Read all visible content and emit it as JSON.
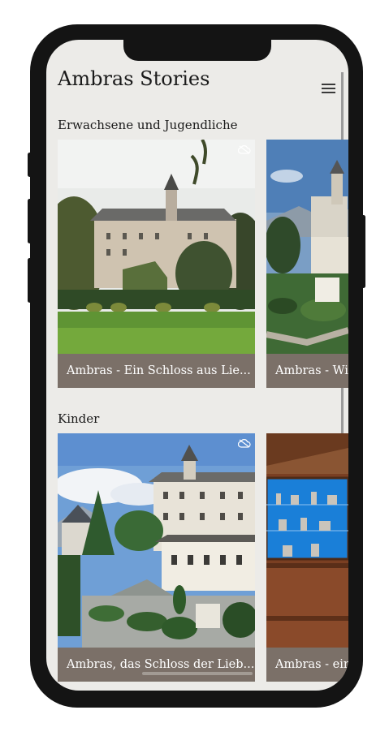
{
  "app": {
    "title": "Ambras Stories",
    "menu_icon": "hamburger-menu-icon"
  },
  "sections": [
    {
      "title": "Erwachsene und Jugendliche",
      "cards": [
        {
          "caption": "Ambras - Ein Schloss aus Lie...",
          "image": "castle-garden-photo"
        },
        {
          "caption": "Ambras - Wi",
          "image": "castle-aerial-garden-photo"
        }
      ]
    },
    {
      "title": "Kinder",
      "cards": [
        {
          "caption": "Ambras, das Schloss der Lieb...",
          "image": "castle-hedge-garden-photo"
        },
        {
          "caption": "Ambras - ein",
          "image": "museum-display-case-photo"
        }
      ]
    }
  ],
  "colors": {
    "background": "#ecebe8",
    "caption_bg": "#7b7068",
    "caption_text": "#ffffff",
    "phone_frame": "#141414"
  }
}
